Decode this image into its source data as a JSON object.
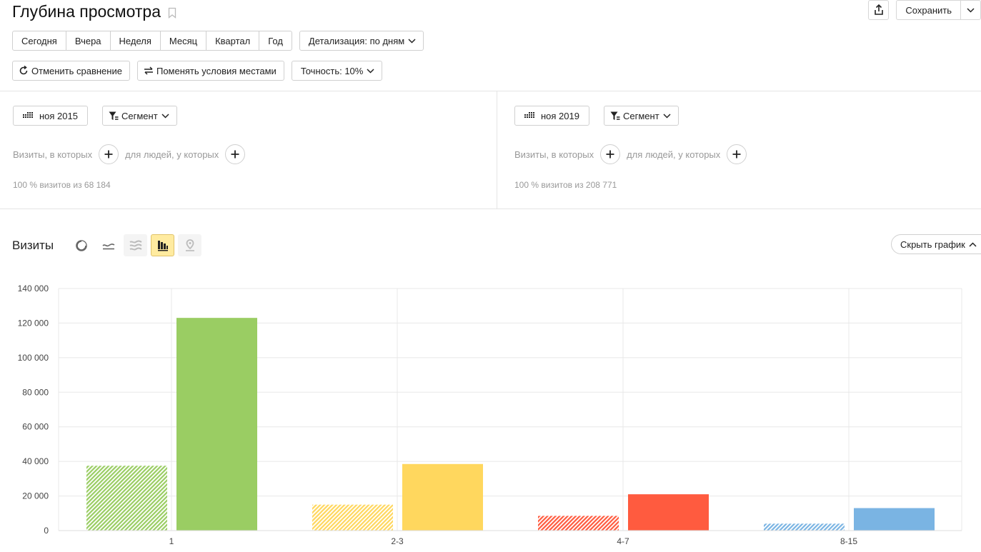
{
  "header": {
    "title": "Глубина просмотра",
    "save_label": "Сохранить"
  },
  "periods": [
    "Сегодня",
    "Вчера",
    "Неделя",
    "Месяц",
    "Квартал",
    "Год"
  ],
  "detail_label": "Детализация: по дням",
  "compare": {
    "cancel_label": "Отменить сравнение",
    "swap_label": "Поменять условия местами",
    "accuracy_label": "Точность: 10%"
  },
  "segments": [
    {
      "date": "ноя 2015",
      "segment_label": "Сегмент",
      "visits_label": "Визиты, в которых",
      "people_label": "для людей, у которых",
      "summary": "100 % визитов из 68 184"
    },
    {
      "date": "ноя 2019",
      "segment_label": "Сегмент",
      "visits_label": "Визиты, в которых",
      "people_label": "для людей, у которых",
      "summary": "100 % визитов из 208 771"
    }
  ],
  "chart_section": {
    "title": "Визиты",
    "hide_label": "Скрыть график",
    "icons": [
      "pie-chart-icon",
      "line-chart-icon",
      "stacked-area-icon",
      "bar-chart-icon",
      "map-icon"
    ]
  },
  "chart_data": {
    "type": "bar",
    "categories": [
      "1",
      "2-3",
      "4-7",
      "8-15"
    ],
    "series": [
      {
        "values": [
          37500,
          15000,
          8500,
          4000
        ]
      },
      {
        "values": [
          123000,
          38500,
          21000,
          13000
        ]
      }
    ],
    "colors": [
      "#9acd63",
      "#ffd75e",
      "#ff5b3f",
      "#7ab4e3"
    ],
    "ylim": [
      0,
      140000
    ],
    "yticks": [
      "0",
      "20 000",
      "40 000",
      "60 000",
      "80 000",
      "100 000",
      "120 000",
      "140 000"
    ],
    "grid": true
  }
}
